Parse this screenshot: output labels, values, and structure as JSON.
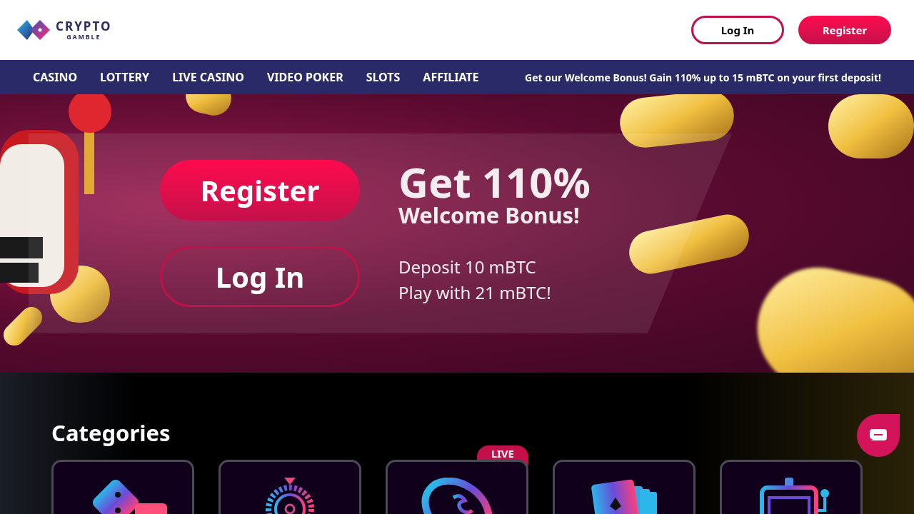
{
  "header": {
    "logo": {
      "line_1": "CRYPTO",
      "line_2": "GAMBLE"
    },
    "buttons": [
      {
        "label": "Log In",
        "kind": "outline"
      },
      {
        "label": "Register",
        "kind": "filled"
      }
    ]
  },
  "nav": {
    "items": [
      "CASINO",
      "LOTTERY",
      "LIVE CASINO",
      "VIDEO POKER",
      "SLOTS",
      "AFFILIATE"
    ],
    "promo": "Get our Welcome Bonus! Gain 110% up to 15 mBTC on your first deposit!"
  },
  "hero": {
    "buttons": [
      {
        "label": "Register",
        "kind": "filled"
      },
      {
        "label": "Log In",
        "kind": "outline"
      }
    ],
    "headline": "Get 110%",
    "subheadline": "Welcome Bonus!",
    "lines": [
      "Deposit 10 mBTC",
      "Play with 21 mBTC!"
    ]
  },
  "categories": {
    "title": "Categories",
    "items": [
      {
        "kind": "dice"
      },
      {
        "kind": "roulette"
      },
      {
        "kind": "chip",
        "badge": "LIVE"
      },
      {
        "kind": "cards"
      },
      {
        "kind": "slots"
      }
    ]
  }
}
